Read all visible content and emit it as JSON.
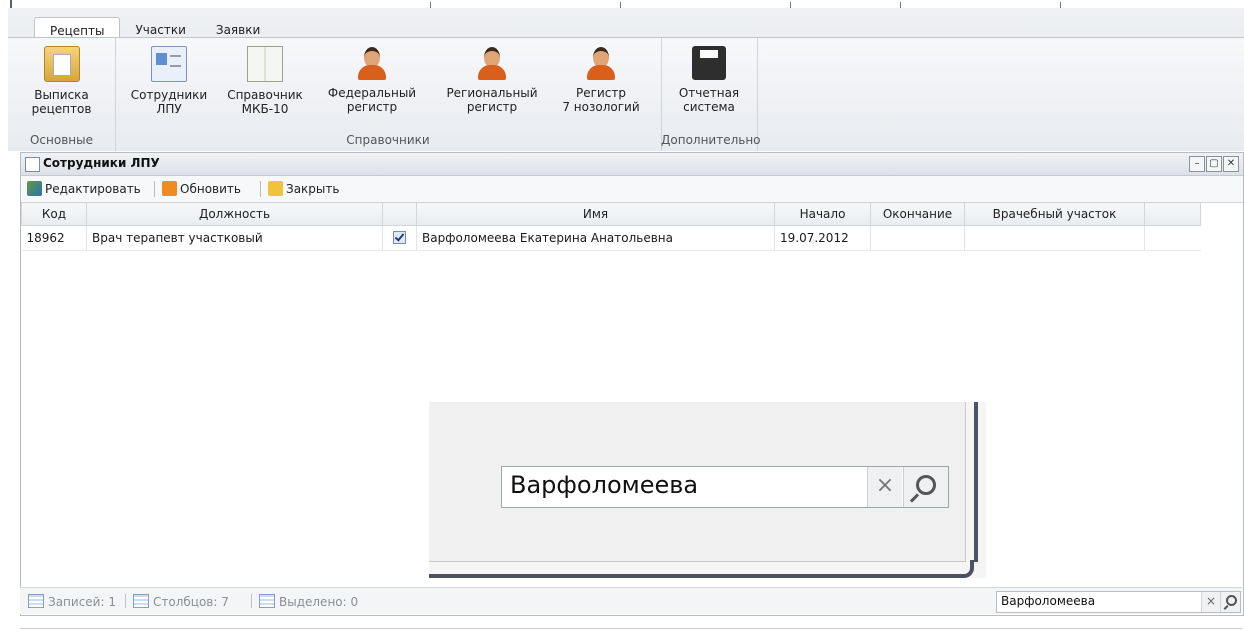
{
  "ribbon": {
    "tabs": [
      "Рецепты",
      "Участки",
      "Заявки"
    ],
    "groups": {
      "basic": {
        "label": "Основные",
        "buttons": [
          {
            "line1": "Выписка",
            "line2": "рецептов",
            "icon": "clipboard-icon"
          }
        ]
      },
      "refs": {
        "label": "Справочники",
        "buttons": [
          {
            "line1": "Сотрудники",
            "line2": "ЛПУ",
            "icon": "id-card-icon"
          },
          {
            "line1": "Справочник",
            "line2": "МКБ-10",
            "icon": "book-icon"
          },
          {
            "line1": "Федеральный",
            "line2": "регистр",
            "icon": "person-icon"
          },
          {
            "line1": "Региональный",
            "line2": "регистр",
            "icon": "person-icon"
          },
          {
            "line1": "Регистр",
            "line2": "7 нозологий",
            "icon": "person-icon"
          }
        ]
      },
      "extra": {
        "label": "Дополнительно",
        "buttons": [
          {
            "line1": "Отчетная",
            "line2": "система",
            "icon": "printer-icon"
          }
        ]
      }
    }
  },
  "window": {
    "title": "Сотрудники ЛПУ",
    "toolbar": {
      "edit": "Редактировать",
      "refresh": "Обновить",
      "close": "Закрыть"
    },
    "columns": [
      "Код",
      "Должность",
      "",
      "Имя",
      "Начало",
      "Окончание",
      "Врачебный участок"
    ],
    "rows": [
      {
        "code": "18962",
        "position": "Врач терапевт участковый",
        "checked": true,
        "name": "Варфоломеева Екатерина Анатольевна",
        "start": "19.07.2012",
        "end": "",
        "district": ""
      }
    ]
  },
  "status": {
    "records": "Записей: 1",
    "columns": "Столбцов: 7",
    "selected": "Выделено: 0",
    "search_value": "Варфоломеева"
  },
  "zoom": {
    "search_value": "Варфоломеева"
  },
  "colors": {
    "accent": "#d95f1a",
    "window_border": "#b7bdc6"
  }
}
